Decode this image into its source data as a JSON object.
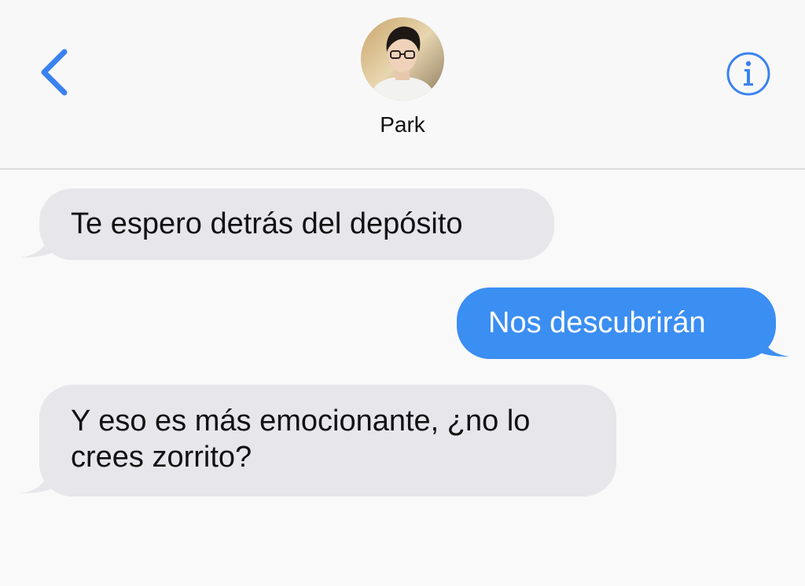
{
  "header": {
    "back_icon": "chevron-left-icon",
    "info_icon": "info-circle-icon",
    "contact_name": "Park",
    "accent_color": "#3b8ef2"
  },
  "messages": [
    {
      "direction": "incoming",
      "text": "Te espero detrás del depósito"
    },
    {
      "direction": "outgoing",
      "text": "Nos descubrirán"
    },
    {
      "direction": "incoming",
      "text": "Y eso es más emocionante, ¿no lo crees zorrito?"
    }
  ],
  "colors": {
    "incoming_bubble": "#e6e6eb",
    "outgoing_bubble": "#3b8ef2",
    "background": "#f9f9f9"
  }
}
